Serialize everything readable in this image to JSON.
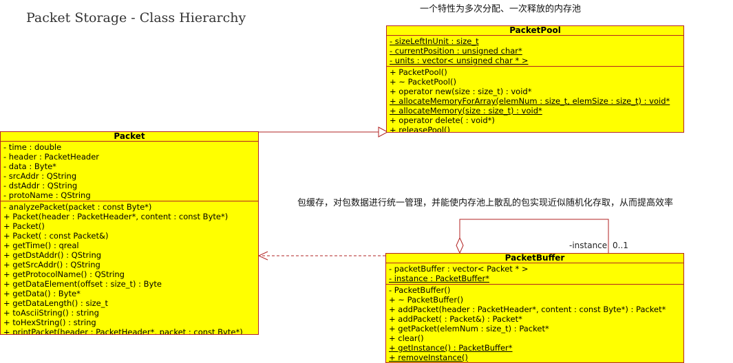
{
  "title": "Packet Storage - Class Hierarchy",
  "notes": {
    "pool_note": "一个特性为多次分配、一次释放的内存池",
    "buffer_note": "包缓存，对包数据进行统一管理，并能使内存池上散乱的包实现近似随机化存取，从而提高效率"
  },
  "colors": {
    "class_fill": "#ffff00",
    "class_border": "#b22222",
    "relation_line": "#b22222"
  },
  "classes": {
    "packet_pool": {
      "name": "PacketPool",
      "attributes": [
        {
          "text": "- sizeLeftInUnit : size_t",
          "static": true
        },
        {
          "text": "- currentPosition : unsigned char*",
          "static": true
        },
        {
          "text": "- units : vector< unsigned char * >",
          "static": true
        }
      ],
      "operations": [
        {
          "text": "+ PacketPool()",
          "static": false
        },
        {
          "text": "+ ~ PacketPool()",
          "static": false
        },
        {
          "text": "+ operator new(size : size_t) : void*",
          "static": false
        },
        {
          "text": "+ allocateMemoryForArray(elemNum : size_t, elemSize : size_t) : void*",
          "static": true
        },
        {
          "text": "+ allocateMemory(size : size_t) : void*",
          "static": true
        },
        {
          "text": "+ operator delete( : void*)",
          "static": false
        },
        {
          "text": "+ releasePool()",
          "static": true
        }
      ]
    },
    "packet": {
      "name": "Packet",
      "attributes": [
        {
          "text": "- time : double",
          "static": false
        },
        {
          "text": "- header : PacketHeader",
          "static": false
        },
        {
          "text": "- data : Byte*",
          "static": false
        },
        {
          "text": "- srcAddr : QString",
          "static": false
        },
        {
          "text": "- dstAddr : QString",
          "static": false
        },
        {
          "text": "- protoName : QString",
          "static": false
        }
      ],
      "operations": [
        {
          "text": "- analyzePacket(packet : const Byte*)",
          "static": false
        },
        {
          "text": "+ Packet(header : PacketHeader*, content : const Byte*)",
          "static": false
        },
        {
          "text": "+ Packet()",
          "static": false
        },
        {
          "text": "+ Packet( : const Packet&)",
          "static": false
        },
        {
          "text": "+ getTime() : qreal",
          "static": false
        },
        {
          "text": "+ getDstAddr() : QString",
          "static": false
        },
        {
          "text": "+ getSrcAddr() : QString",
          "static": false
        },
        {
          "text": "+ getProtocolName() : QString",
          "static": false
        },
        {
          "text": "+ getDataElement(offset : size_t) : Byte",
          "static": false
        },
        {
          "text": "+ getData() : Byte*",
          "static": false
        },
        {
          "text": "+ getDataLength() : size_t",
          "static": false
        },
        {
          "text": "+ toAsciiString() : string",
          "static": false
        },
        {
          "text": "+ toHexString() : string",
          "static": false
        },
        {
          "text": "+ printPacket(header : PacketHeader*, packet : const Byte*)",
          "static": true
        }
      ]
    },
    "packet_buffer": {
      "name": "PacketBuffer",
      "attributes": [
        {
          "text": "- packetBuffer : vector< Packet * >",
          "static": false
        },
        {
          "text": "- instance : PacketBuffer*",
          "static": true
        }
      ],
      "operations": [
        {
          "text": "- PacketBuffer()",
          "static": false
        },
        {
          "text": "+ ~ PacketBuffer()",
          "static": false
        },
        {
          "text": "+ addPacket(header : PacketHeader*, content : const Byte*) : Packet*",
          "static": false
        },
        {
          "text": "+ addPacket( : Packet&) : Packet*",
          "static": false
        },
        {
          "text": "+ getPacket(elemNum : size_t) : Packet*",
          "static": false
        },
        {
          "text": "+ clear()",
          "static": false
        },
        {
          "text": "+ getInstance() : PacketBuffer*",
          "static": true
        },
        {
          "text": "+ removeInstance()",
          "static": true
        }
      ]
    }
  },
  "relations": {
    "self_assoc_role": "-instance",
    "self_assoc_multiplicity": "0..1"
  }
}
